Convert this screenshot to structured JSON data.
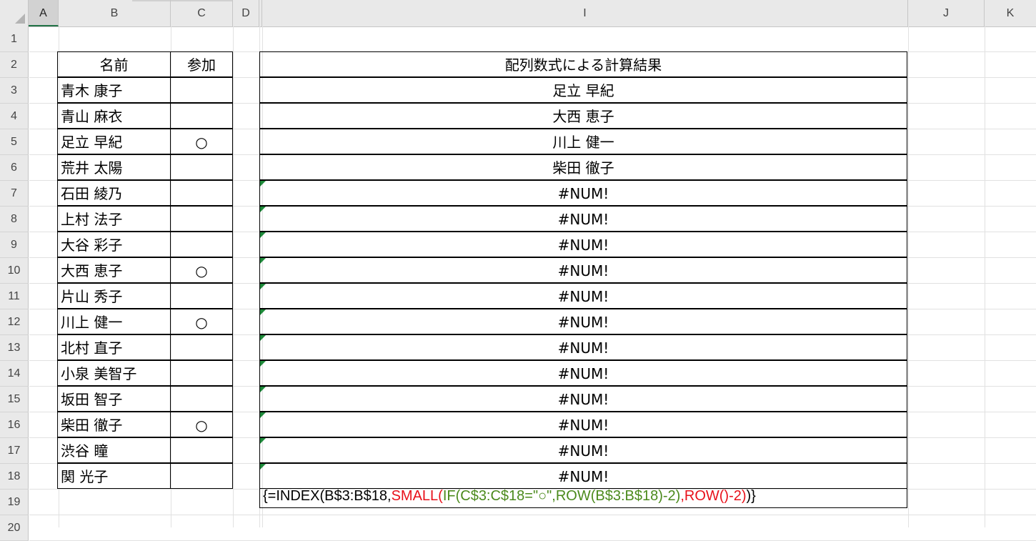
{
  "columns": [
    "A",
    "B",
    "C",
    "D",
    "I",
    "J",
    "K"
  ],
  "rows": [
    "1",
    "2",
    "3",
    "4",
    "5",
    "6",
    "7",
    "8",
    "9",
    "10",
    "11",
    "12",
    "13",
    "14",
    "15",
    "16",
    "17",
    "18",
    "19",
    "20"
  ],
  "left_table": {
    "header_name": "名前",
    "header_join": "参加",
    "rows": [
      {
        "name": "青木 康子",
        "join": ""
      },
      {
        "name": "青山 麻衣",
        "join": ""
      },
      {
        "name": "足立 早紀",
        "join": "○"
      },
      {
        "name": "荒井 太陽",
        "join": ""
      },
      {
        "name": "石田 綾乃",
        "join": ""
      },
      {
        "name": "上村 法子",
        "join": ""
      },
      {
        "name": "大谷 彩子",
        "join": ""
      },
      {
        "name": "大西 恵子",
        "join": "○"
      },
      {
        "name": "片山 秀子",
        "join": ""
      },
      {
        "name": "川上 健一",
        "join": "○"
      },
      {
        "name": "北村 直子",
        "join": ""
      },
      {
        "name": "小泉 美智子",
        "join": ""
      },
      {
        "name": "坂田 智子",
        "join": ""
      },
      {
        "name": "柴田 徹子",
        "join": "○"
      },
      {
        "name": "渋谷 瞳",
        "join": ""
      },
      {
        "name": "関 光子",
        "join": ""
      }
    ]
  },
  "right_table": {
    "header": "配列数式による計算結果",
    "results": [
      "足立 早紀",
      "大西 恵子",
      "川上 健一",
      "柴田 徹子",
      "#NUM!",
      "#NUM!",
      "#NUM!",
      "#NUM!",
      "#NUM!",
      "#NUM!",
      "#NUM!",
      "#NUM!",
      "#NUM!",
      "#NUM!",
      "#NUM!",
      "#NUM!"
    ],
    "error_flags": [
      false,
      false,
      false,
      false,
      true,
      true,
      true,
      true,
      true,
      true,
      true,
      true,
      true,
      true,
      true,
      true
    ]
  },
  "formula": {
    "p1": "{=INDEX(B$3:B$18,",
    "p2": "SMALL(",
    "p3": "IF(C$3:C$18=\"○\",ROW(B$3:B$18)-2)",
    "p4": ",ROW()-2)",
    "p5": ")}"
  },
  "colors": {
    "formula_red": "#e8101a",
    "formula_green": "#4b8a1c",
    "error_marker": "#1e8a3a",
    "selected_col_underline": "#217346"
  }
}
